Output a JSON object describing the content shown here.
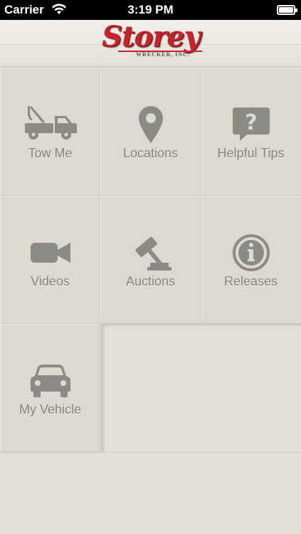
{
  "status_bar": {
    "carrier": "Carrier",
    "time": "3:19 PM"
  },
  "header": {
    "logo_name": "Storey",
    "logo_tagline": "WRECKER, INC."
  },
  "menu": {
    "tiles": [
      {
        "label": "Tow Me",
        "icon": "tow-truck-icon"
      },
      {
        "label": "Locations",
        "icon": "map-pin-icon"
      },
      {
        "label": "Helpful Tips",
        "icon": "question-bubble-icon"
      },
      {
        "label": "Videos",
        "icon": "video-camera-icon"
      },
      {
        "label": "Auctions",
        "icon": "gavel-icon"
      },
      {
        "label": "Releases",
        "icon": "info-icon"
      },
      {
        "label": "My Vehicle",
        "icon": "car-icon"
      }
    ]
  },
  "colors": {
    "background": "#e3e0d9",
    "tile": "#dcd9d1",
    "icon": "#8a8a86",
    "logo_red": "#c8232c"
  }
}
